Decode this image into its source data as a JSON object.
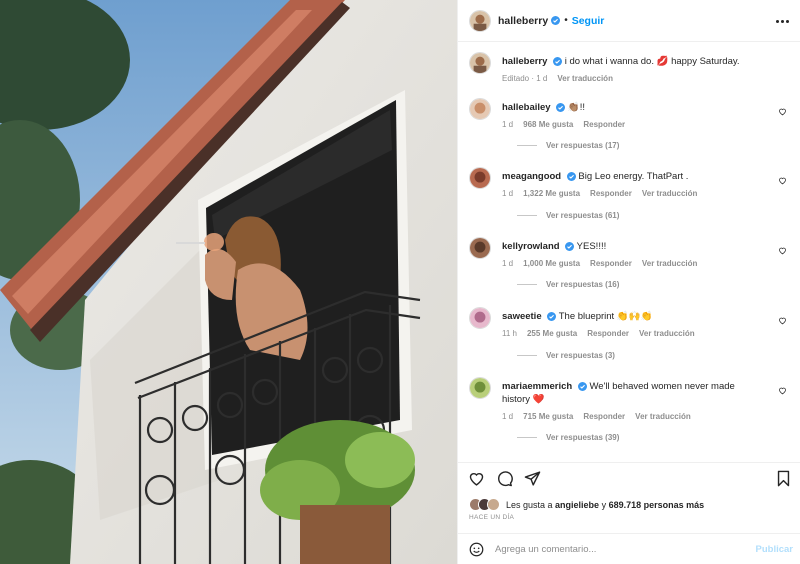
{
  "post": {
    "username": "halleberry",
    "follow_label": "Seguir"
  },
  "caption": {
    "username": "halleberry",
    "text": "i do what i wanna do. 💋 happy Saturday.",
    "edited": "Editado",
    "time": "1 d",
    "translate": "Ver traducción"
  },
  "comments": [
    {
      "username": "hallebailey",
      "text": "👏🏽!!",
      "time": "1 d",
      "likes": "968 Me gusta",
      "reply": "Responder",
      "translate": "",
      "replies": "Ver respuestas (17)",
      "avatar_color": "#c98f6a"
    },
    {
      "username": "meagangood",
      "text": "Big Leo energy. ThatPart .",
      "time": "1 d",
      "likes": "1,322 Me gusta",
      "reply": "Responder",
      "translate": "Ver traducción",
      "replies": "Ver respuestas (61)",
      "avatar_color": "#7a3b2b"
    },
    {
      "username": "kellyrowland",
      "text": "YES!!!!",
      "time": "1 d",
      "likes": "1,000 Me gusta",
      "reply": "Responder",
      "translate": "Ver traducción",
      "replies": "Ver respuestas (16)",
      "avatar_color": "#5a3a2a"
    },
    {
      "username": "saweetie",
      "text": "The blueprint 👏🙌👏",
      "time": "11 h",
      "likes": "255 Me gusta",
      "reply": "Responder",
      "translate": "Ver traducción",
      "replies": "Ver respuestas (3)",
      "avatar_color": "#b06b8c"
    },
    {
      "username": "mariaemmerich",
      "text": "We'll behaved women never made history ❤️",
      "time": "1 d",
      "likes": "715 Me gusta",
      "reply": "Responder",
      "translate": "Ver traducción",
      "replies": "Ver respuestas (39)",
      "avatar_color": "#6f8f3a"
    }
  ],
  "likes": {
    "prefix": "Les gusta a ",
    "first_user": "angieliebe",
    "middle": " y ",
    "count": "689.718 personas más",
    "time_ago": "HACE UN DÍA"
  },
  "add_comment": {
    "placeholder": "Agrega un comentario...",
    "publish_label": "Publicar"
  },
  "colors": {
    "accent": "#0095f6",
    "verified": "#3897f0",
    "muted": "#8e8e8e"
  },
  "icons": [
    "verified-badge-icon",
    "more-options-icon",
    "heart-icon",
    "comment-icon",
    "share-icon",
    "bookmark-icon",
    "emoji-icon"
  ]
}
